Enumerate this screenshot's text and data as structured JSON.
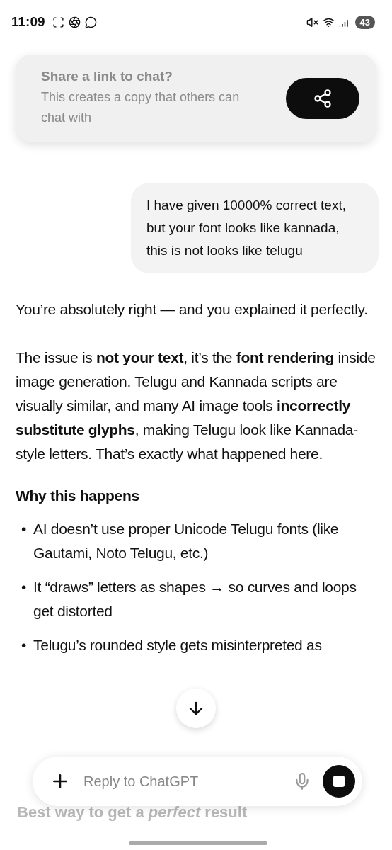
{
  "status_bar": {
    "time": "11:09",
    "battery": "43"
  },
  "share_prompt": {
    "title": "Share a link to chat?",
    "body": "This creates a copy that others can chat with"
  },
  "user_message": {
    "text": "I have given 10000% correct text, but your font looks like kannada, this is not looks like telugu"
  },
  "assistant_blocks": [
    {
      "kind": "paragraph",
      "text": "You’re absolutely right — and you explained it perfectly."
    },
    {
      "kind": "paragraph",
      "text": "The issue is **not your text**, it’s the **font rendering** inside image generation. Telugu and Kannada scripts are visually similar, and many AI image tools **incorrectly substitute glyphs**, making Telugu look like Kannada-style letters. That’s exactly what happened here."
    },
    {
      "kind": "heading",
      "text": "Why this happens"
    },
    {
      "kind": "bullets",
      "marker": "•",
      "items": [
        "AI doesn’t use proper Unicode Telugu fonts (like Gautami, Noto Telugu, etc.)",
        "It “draws” letters as shapes → so curves and loops get distorted",
        "Telugu’s rounded style gets misinterpreted as"
      ]
    }
  ],
  "faded_heading": "Best way to get a *perfect* result",
  "composer": {
    "placeholder": "Reply to ChatGPT"
  }
}
